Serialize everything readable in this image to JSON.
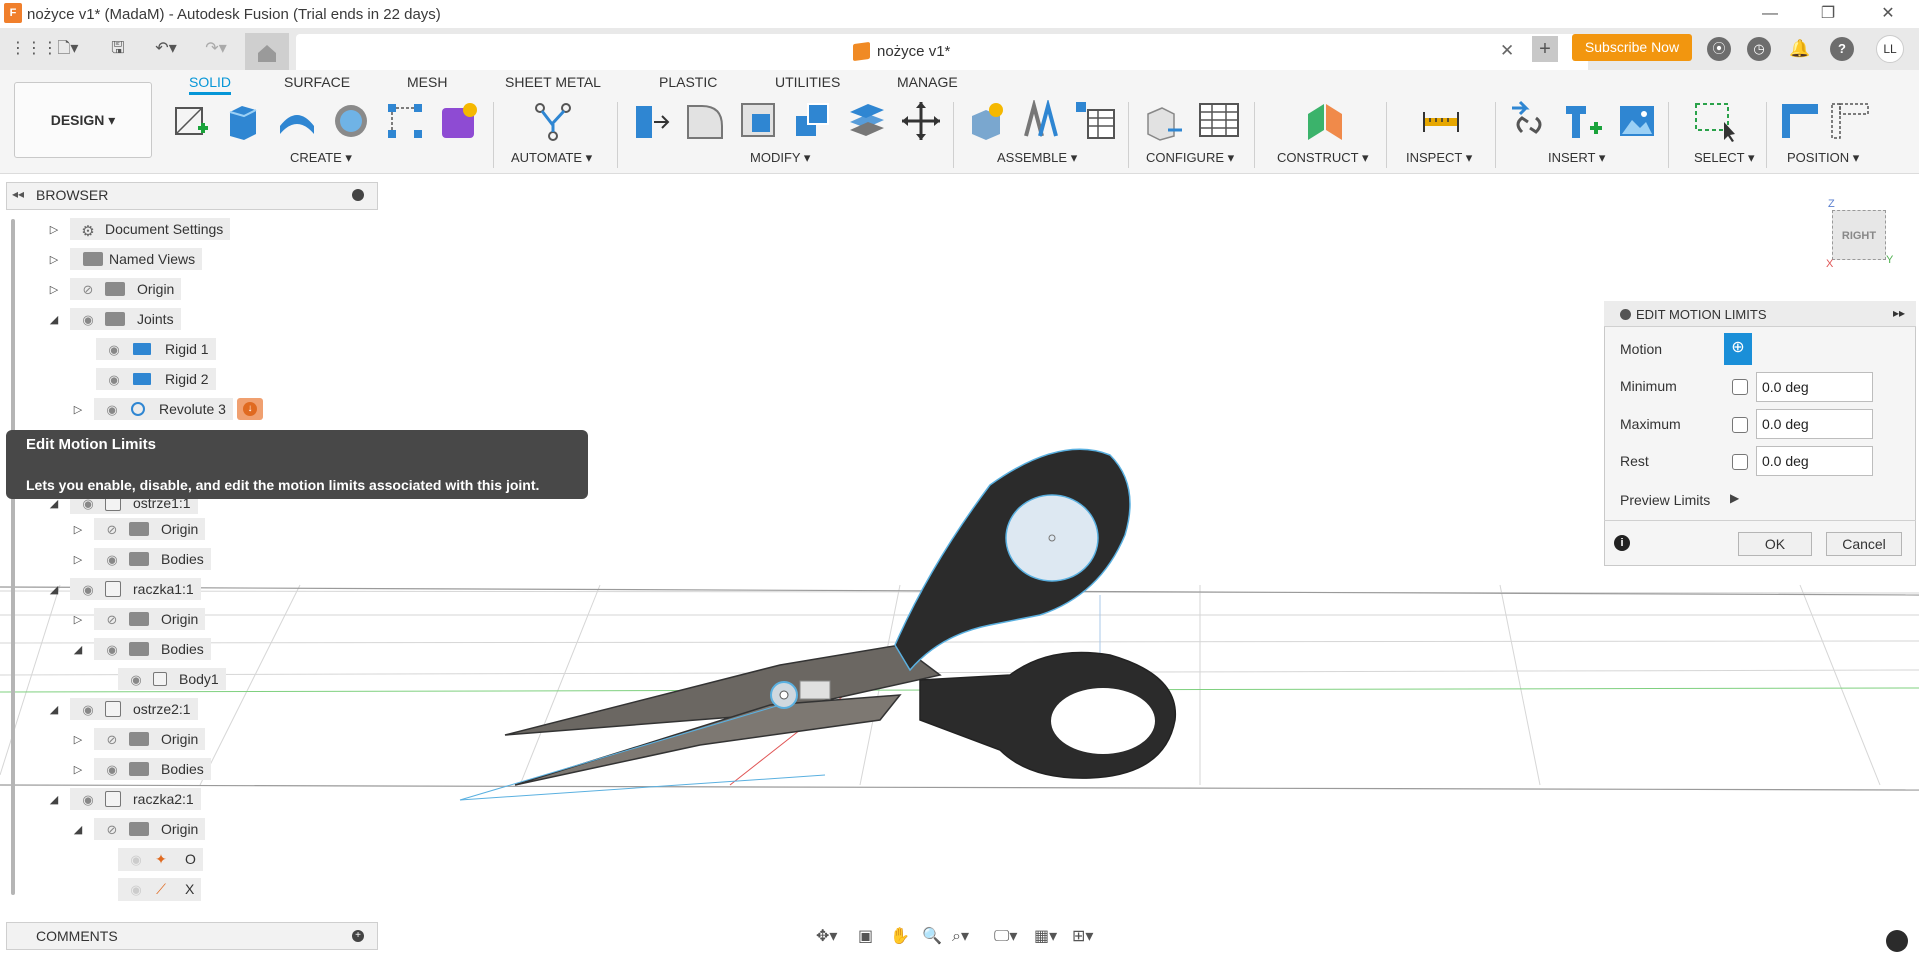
{
  "window": {
    "title": "nożyce v1* (MadaM) - Autodesk Fusion (Trial ends in 22 days)",
    "app_icon": "F",
    "minimize": "—",
    "maximize": "❐",
    "close": "✕"
  },
  "tabs": {
    "document_title": "nożyce v1*",
    "close": "✕",
    "new_tab": "+",
    "subscribe_label": "Subscribe Now",
    "avatar": "LL",
    "help": "?"
  },
  "ribbon": {
    "workspace": "DESIGN ▾",
    "tabs": [
      "SOLID",
      "SURFACE",
      "MESH",
      "SHEET METAL",
      "PLASTIC",
      "UTILITIES",
      "MANAGE"
    ],
    "groups": [
      "CREATE ▾",
      "AUTOMATE ▾",
      "MODIFY ▾",
      "ASSEMBLE ▾",
      "CONFIGURE ▾",
      "CONSTRUCT ▾",
      "INSPECT ▾",
      "INSERT ▾",
      "SELECT ▾",
      "POSITION ▾"
    ]
  },
  "browser": {
    "title": "BROWSER",
    "items": [
      {
        "label": "Document Settings"
      },
      {
        "label": "Named Views"
      },
      {
        "label": "Origin"
      },
      {
        "label": "Joints"
      },
      {
        "label": "Rigid 1"
      },
      {
        "label": "Rigid 2"
      },
      {
        "label": "Revolute 3"
      },
      {
        "label": "ostrze1:1"
      },
      {
        "label": "Origin"
      },
      {
        "label": "Bodies"
      },
      {
        "label": "raczka1:1"
      },
      {
        "label": "Origin"
      },
      {
        "label": "Bodies"
      },
      {
        "label": "Body1"
      },
      {
        "label": "ostrze2:1"
      },
      {
        "label": "Origin"
      },
      {
        "label": "Bodies"
      },
      {
        "label": "raczka2:1"
      },
      {
        "label": "Origin"
      },
      {
        "label": "O"
      },
      {
        "label": "X"
      }
    ]
  },
  "tooltip": {
    "title": "Edit Motion Limits",
    "description": "Lets you enable, disable, and edit the motion limits associated with this joint."
  },
  "comments": {
    "label": "COMMENTS"
  },
  "viewcube": {
    "face": "RIGHT",
    "z": "Z",
    "y": "Y",
    "x": "X"
  },
  "dialog": {
    "title": "EDIT MOTION LIMITS",
    "motion_label": "Motion",
    "minimum_label": "Minimum",
    "minimum_value": "0.0 deg",
    "maximum_label": "Maximum",
    "maximum_value": "0.0 deg",
    "rest_label": "Rest",
    "rest_value": "0.0 deg",
    "preview_label": "Preview Limits",
    "ok_label": "OK",
    "cancel_label": "Cancel",
    "info": "i"
  },
  "colors": {
    "accent": "#0696d7",
    "subscribe": "#f2960f",
    "tooltip_bg": "#484848"
  }
}
